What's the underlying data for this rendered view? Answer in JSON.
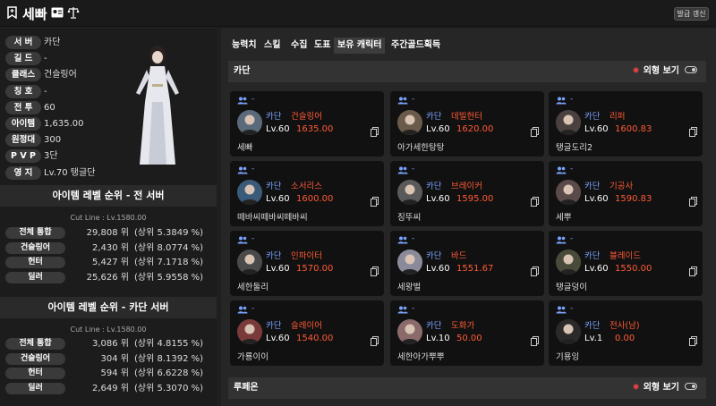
{
  "header": {
    "name": "세빠",
    "refresh_label": "발급 갱신"
  },
  "profile": [
    {
      "key": "서 버",
      "value": "카단"
    },
    {
      "key": "길 드",
      "value": "-"
    },
    {
      "key": "클래스",
      "value": "건슬링어"
    },
    {
      "key": "칭 호",
      "value": "-"
    },
    {
      "key": "전 투",
      "value": "60"
    },
    {
      "key": "아이템",
      "value": "1,635.00"
    },
    {
      "key": "원정대",
      "value": "300"
    },
    {
      "key": "P V P",
      "value": "3단"
    },
    {
      "key": "영 지",
      "value": "Lv.70 탱글단"
    }
  ],
  "rank_all": {
    "title": "아이템 레벨 순위 - 전 서버",
    "cutline": "Cut Line : Lv.1580.00",
    "rows": [
      {
        "key": "전체 통합",
        "pos": "29,808 위",
        "pct": "(상위   5.3849 %)"
      },
      {
        "key": "건슬링어",
        "pos": "2,430 위",
        "pct": "(상위   8.0774 %)"
      },
      {
        "key": "헌터",
        "pos": "5,427 위",
        "pct": "(상위   7.1718 %)"
      },
      {
        "key": "딜러",
        "pos": "25,626 위",
        "pct": "(상위   5.9558 %)"
      }
    ]
  },
  "rank_server": {
    "title": "아이템 레벨 순위 - 카단 서버",
    "cutline": "Cut Line : Lv.1580.00",
    "rows": [
      {
        "key": "전체 통합",
        "pos": "3,086 위",
        "pct": "(상위   4.8155 %)"
      },
      {
        "key": "건슬링어",
        "pos": "304 위",
        "pct": "(상위   8.1392 %)"
      },
      {
        "key": "헌터",
        "pos": "594 위",
        "pct": "(상위   6.6228 %)"
      },
      {
        "key": "딜러",
        "pos": "2,649 위",
        "pct": "(상위   5.3070 %)"
      }
    ]
  },
  "tabs": [
    "능력치",
    "스킬",
    "수집",
    "도표",
    "보유 캐릭터",
    "주간골드획득"
  ],
  "sections": [
    {
      "title": "카단",
      "view_label": "외형 보기"
    },
    {
      "title": "루페온",
      "view_label": "외형 보기"
    }
  ],
  "characters": [
    {
      "dash": "-",
      "server": "카단",
      "cls": "건슬링어",
      "lv": "Lv.60",
      "ilvl": "1635.00",
      "name": "세빠",
      "color": "#5a6a7a"
    },
    {
      "dash": "-",
      "server": "카단",
      "cls": "데빌헌터",
      "lv": "Lv.60",
      "ilvl": "1620.00",
      "name": "아가세한탕탕",
      "color": "#6a5a4a"
    },
    {
      "dash": "-",
      "server": "카단",
      "cls": "리퍼",
      "lv": "Lv.60",
      "ilvl": "1600.83",
      "name": "탱글도리2",
      "color": "#4a4040"
    },
    {
      "dash": "-",
      "server": "카단",
      "cls": "소서리스",
      "lv": "Lv.60",
      "ilvl": "1600.00",
      "name": "떼바씨떼바씨떼바씨",
      "color": "#3a5a7a"
    },
    {
      "dash": "-",
      "server": "카단",
      "cls": "브레이커",
      "lv": "Lv.60",
      "ilvl": "1595.00",
      "name": "징뚜씨",
      "color": "#5a5a5a"
    },
    {
      "dash": "-",
      "server": "카단",
      "cls": "기공사",
      "lv": "Lv.60",
      "ilvl": "1590.83",
      "name": "세뿌",
      "color": "#5a4a4a"
    },
    {
      "dash": "-",
      "server": "카단",
      "cls": "인파이터",
      "lv": "Lv.60",
      "ilvl": "1570.00",
      "name": "세한둘리",
      "color": "#4a4a4a"
    },
    {
      "dash": "-",
      "server": "카단",
      "cls": "바드",
      "lv": "Lv.60",
      "ilvl": "1551.67",
      "name": "세왕벌",
      "color": "#8a8a9a"
    },
    {
      "dash": "-",
      "server": "카단",
      "cls": "블레이드",
      "lv": "Lv.60",
      "ilvl": "1550.00",
      "name": "탱글덩이",
      "color": "#4a4a3a"
    },
    {
      "dash": "-",
      "server": "카단",
      "cls": "슬레이어",
      "lv": "Lv.60",
      "ilvl": "1540.00",
      "name": "가룡이이",
      "color": "#7a3a3a"
    },
    {
      "dash": "-",
      "server": "카단",
      "cls": "도화가",
      "lv": "Lv.10",
      "ilvl": "50.00",
      "name": "세한아가뿌뿌",
      "color": "#8a6a6a"
    },
    {
      "dash": "-",
      "server": "카단",
      "cls": "전사(남)",
      "lv": "Lv.1",
      "ilvl": "0.00",
      "name": "기용잉",
      "color": "#2a2a2a"
    }
  ]
}
